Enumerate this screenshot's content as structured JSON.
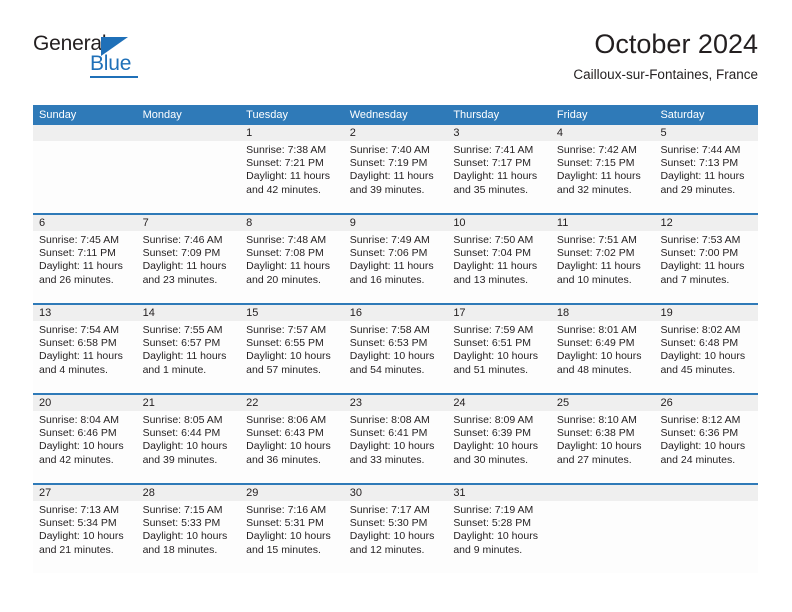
{
  "brand": {
    "name_part1": "General",
    "name_part2": "Blue",
    "triangle_icon": "triangle-icon",
    "accent_color": "#1f70b8"
  },
  "header": {
    "title": "October 2024",
    "subtitle": "Cailloux-sur-Fontaines, France"
  },
  "calendar": {
    "header_bg": "#2f7ab8",
    "row_rule_color": "#2f7ab8",
    "daynum_band_bg": "#efefef",
    "weekdays": [
      "Sunday",
      "Monday",
      "Tuesday",
      "Wednesday",
      "Thursday",
      "Friday",
      "Saturday"
    ],
    "weeks": [
      [
        {
          "day": "",
          "lines": []
        },
        {
          "day": "",
          "lines": []
        },
        {
          "day": "1",
          "lines": [
            "Sunrise: 7:38 AM",
            "Sunset: 7:21 PM",
            "Daylight: 11 hours",
            "and 42 minutes."
          ]
        },
        {
          "day": "2",
          "lines": [
            "Sunrise: 7:40 AM",
            "Sunset: 7:19 PM",
            "Daylight: 11 hours",
            "and 39 minutes."
          ]
        },
        {
          "day": "3",
          "lines": [
            "Sunrise: 7:41 AM",
            "Sunset: 7:17 PM",
            "Daylight: 11 hours",
            "and 35 minutes."
          ]
        },
        {
          "day": "4",
          "lines": [
            "Sunrise: 7:42 AM",
            "Sunset: 7:15 PM",
            "Daylight: 11 hours",
            "and 32 minutes."
          ]
        },
        {
          "day": "5",
          "lines": [
            "Sunrise: 7:44 AM",
            "Sunset: 7:13 PM",
            "Daylight: 11 hours",
            "and 29 minutes."
          ]
        }
      ],
      [
        {
          "day": "6",
          "lines": [
            "Sunrise: 7:45 AM",
            "Sunset: 7:11 PM",
            "Daylight: 11 hours",
            "and 26 minutes."
          ]
        },
        {
          "day": "7",
          "lines": [
            "Sunrise: 7:46 AM",
            "Sunset: 7:09 PM",
            "Daylight: 11 hours",
            "and 23 minutes."
          ]
        },
        {
          "day": "8",
          "lines": [
            "Sunrise: 7:48 AM",
            "Sunset: 7:08 PM",
            "Daylight: 11 hours",
            "and 20 minutes."
          ]
        },
        {
          "day": "9",
          "lines": [
            "Sunrise: 7:49 AM",
            "Sunset: 7:06 PM",
            "Daylight: 11 hours",
            "and 16 minutes."
          ]
        },
        {
          "day": "10",
          "lines": [
            "Sunrise: 7:50 AM",
            "Sunset: 7:04 PM",
            "Daylight: 11 hours",
            "and 13 minutes."
          ]
        },
        {
          "day": "11",
          "lines": [
            "Sunrise: 7:51 AM",
            "Sunset: 7:02 PM",
            "Daylight: 11 hours",
            "and 10 minutes."
          ]
        },
        {
          "day": "12",
          "lines": [
            "Sunrise: 7:53 AM",
            "Sunset: 7:00 PM",
            "Daylight: 11 hours",
            "and 7 minutes."
          ]
        }
      ],
      [
        {
          "day": "13",
          "lines": [
            "Sunrise: 7:54 AM",
            "Sunset: 6:58 PM",
            "Daylight: 11 hours",
            "and 4 minutes."
          ]
        },
        {
          "day": "14",
          "lines": [
            "Sunrise: 7:55 AM",
            "Sunset: 6:57 PM",
            "Daylight: 11 hours",
            "and 1 minute."
          ]
        },
        {
          "day": "15",
          "lines": [
            "Sunrise: 7:57 AM",
            "Sunset: 6:55 PM",
            "Daylight: 10 hours",
            "and 57 minutes."
          ]
        },
        {
          "day": "16",
          "lines": [
            "Sunrise: 7:58 AM",
            "Sunset: 6:53 PM",
            "Daylight: 10 hours",
            "and 54 minutes."
          ]
        },
        {
          "day": "17",
          "lines": [
            "Sunrise: 7:59 AM",
            "Sunset: 6:51 PM",
            "Daylight: 10 hours",
            "and 51 minutes."
          ]
        },
        {
          "day": "18",
          "lines": [
            "Sunrise: 8:01 AM",
            "Sunset: 6:49 PM",
            "Daylight: 10 hours",
            "and 48 minutes."
          ]
        },
        {
          "day": "19",
          "lines": [
            "Sunrise: 8:02 AM",
            "Sunset: 6:48 PM",
            "Daylight: 10 hours",
            "and 45 minutes."
          ]
        }
      ],
      [
        {
          "day": "20",
          "lines": [
            "Sunrise: 8:04 AM",
            "Sunset: 6:46 PM",
            "Daylight: 10 hours",
            "and 42 minutes."
          ]
        },
        {
          "day": "21",
          "lines": [
            "Sunrise: 8:05 AM",
            "Sunset: 6:44 PM",
            "Daylight: 10 hours",
            "and 39 minutes."
          ]
        },
        {
          "day": "22",
          "lines": [
            "Sunrise: 8:06 AM",
            "Sunset: 6:43 PM",
            "Daylight: 10 hours",
            "and 36 minutes."
          ]
        },
        {
          "day": "23",
          "lines": [
            "Sunrise: 8:08 AM",
            "Sunset: 6:41 PM",
            "Daylight: 10 hours",
            "and 33 minutes."
          ]
        },
        {
          "day": "24",
          "lines": [
            "Sunrise: 8:09 AM",
            "Sunset: 6:39 PM",
            "Daylight: 10 hours",
            "and 30 minutes."
          ]
        },
        {
          "day": "25",
          "lines": [
            "Sunrise: 8:10 AM",
            "Sunset: 6:38 PM",
            "Daylight: 10 hours",
            "and 27 minutes."
          ]
        },
        {
          "day": "26",
          "lines": [
            "Sunrise: 8:12 AM",
            "Sunset: 6:36 PM",
            "Daylight: 10 hours",
            "and 24 minutes."
          ]
        }
      ],
      [
        {
          "day": "27",
          "lines": [
            "Sunrise: 7:13 AM",
            "Sunset: 5:34 PM",
            "Daylight: 10 hours",
            "and 21 minutes."
          ]
        },
        {
          "day": "28",
          "lines": [
            "Sunrise: 7:15 AM",
            "Sunset: 5:33 PM",
            "Daylight: 10 hours",
            "and 18 minutes."
          ]
        },
        {
          "day": "29",
          "lines": [
            "Sunrise: 7:16 AM",
            "Sunset: 5:31 PM",
            "Daylight: 10 hours",
            "and 15 minutes."
          ]
        },
        {
          "day": "30",
          "lines": [
            "Sunrise: 7:17 AM",
            "Sunset: 5:30 PM",
            "Daylight: 10 hours",
            "and 12 minutes."
          ]
        },
        {
          "day": "31",
          "lines": [
            "Sunrise: 7:19 AM",
            "Sunset: 5:28 PM",
            "Daylight: 10 hours",
            "and 9 minutes."
          ]
        },
        {
          "day": "",
          "lines": []
        },
        {
          "day": "",
          "lines": []
        }
      ]
    ]
  }
}
